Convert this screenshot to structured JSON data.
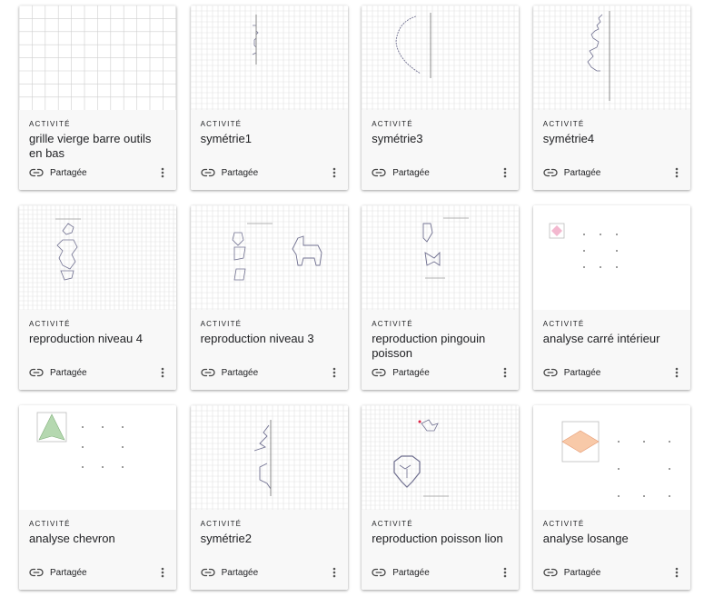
{
  "cards": [
    {
      "kind": "ACTIVITÉ",
      "title": "grille vierge barre outils en bas",
      "shared": "Partagée",
      "thumb": "grid-blank"
    },
    {
      "kind": "ACTIVITÉ",
      "title": "symétrie1",
      "shared": "Partagée",
      "thumb": "symmetry-1"
    },
    {
      "kind": "ACTIVITÉ",
      "title": "symétrie3",
      "shared": "Partagée",
      "thumb": "symmetry-3"
    },
    {
      "kind": "ACTIVITÉ",
      "title": "symétrie4",
      "shared": "Partagée",
      "thumb": "symmetry-4"
    },
    {
      "kind": "ACTIVITÉ",
      "title": "reproduction niveau 4",
      "shared": "Partagée",
      "thumb": "reproduction-4"
    },
    {
      "kind": "ACTIVITÉ",
      "title": "reproduction niveau 3",
      "shared": "Partagée",
      "thumb": "reproduction-3"
    },
    {
      "kind": "ACTIVITÉ",
      "title": "reproduction pingouin poisson",
      "shared": "Partagée",
      "thumb": "reproduction-penguin-fish"
    },
    {
      "kind": "ACTIVITÉ",
      "title": "analyse carré intérieur",
      "shared": "Partagée",
      "thumb": "analysis-square"
    },
    {
      "kind": "ACTIVITÉ",
      "title": "analyse chevron",
      "shared": "Partagée",
      "thumb": "analysis-chevron"
    },
    {
      "kind": "ACTIVITÉ",
      "title": "symétrie2",
      "shared": "Partagée",
      "thumb": "symmetry-2"
    },
    {
      "kind": "ACTIVITÉ",
      "title": "reproduction poisson lion",
      "shared": "Partagée",
      "thumb": "reproduction-fish-lion"
    },
    {
      "kind": "ACTIVITÉ",
      "title": "analyse losange",
      "shared": "Partagée",
      "thumb": "analysis-rhombus"
    }
  ],
  "icons": {
    "shared": "link-icon",
    "menu": "more-vert-icon"
  },
  "colors": {
    "grid": "#dcdcdc",
    "shape": "#707090",
    "green": "#b5d8b0",
    "pink": "#f3b8cf",
    "peach": "#f8c9a8"
  }
}
